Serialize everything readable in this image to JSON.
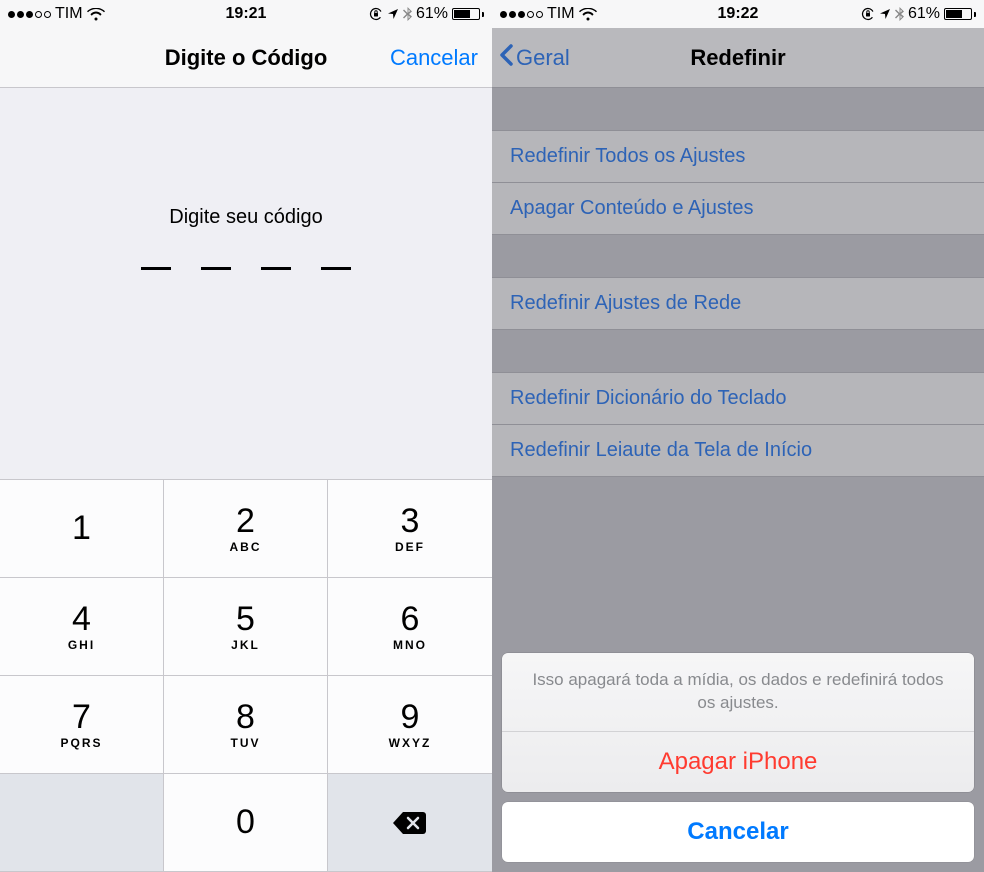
{
  "left": {
    "status": {
      "carrier": "TIM",
      "time": "19:21",
      "battery_pct": "61%"
    },
    "nav": {
      "title": "Digite o Código",
      "cancel": "Cancelar"
    },
    "prompt": "Digite seu código",
    "keypad": {
      "k1": {
        "d": "1",
        "l": ""
      },
      "k2": {
        "d": "2",
        "l": "ABC"
      },
      "k3": {
        "d": "3",
        "l": "DEF"
      },
      "k4": {
        "d": "4",
        "l": "GHI"
      },
      "k5": {
        "d": "5",
        "l": "JKL"
      },
      "k6": {
        "d": "6",
        "l": "MNO"
      },
      "k7": {
        "d": "7",
        "l": "PQRS"
      },
      "k8": {
        "d": "8",
        "l": "TUV"
      },
      "k9": {
        "d": "9",
        "l": "WXYZ"
      },
      "k0": {
        "d": "0",
        "l": ""
      }
    }
  },
  "right": {
    "status": {
      "carrier": "TIM",
      "time": "19:22",
      "battery_pct": "61%"
    },
    "nav": {
      "back": "Geral",
      "title": "Redefinir"
    },
    "rows": {
      "r1": "Redefinir Todos os Ajustes",
      "r2": "Apagar Conteúdo e Ajustes",
      "r3": "Redefinir Ajustes de Rede",
      "r4": "Redefinir Dicionário do Teclado",
      "r5": "Redefinir Leiaute da Tela de Início"
    },
    "sheet": {
      "msg": "Isso apagará toda a mídia, os dados e redefinirá todos os ajustes.",
      "erase": "Apagar iPhone",
      "cancel": "Cancelar"
    }
  }
}
